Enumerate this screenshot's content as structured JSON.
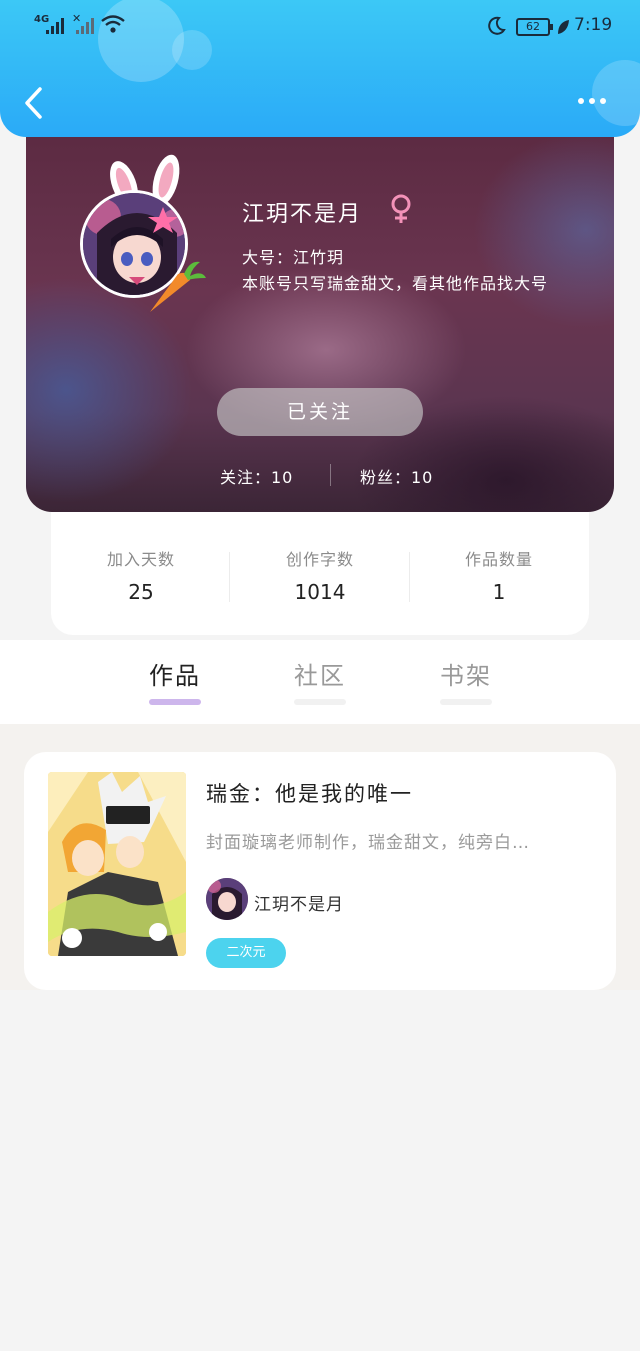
{
  "status_bar": {
    "network": "4G",
    "battery": "62",
    "time": "7:19"
  },
  "profile": {
    "nickname": "江玥不是月",
    "bio_line1": "大号：江竹玥",
    "bio_line2": "本账号只写瑞金甜文，看其他作品找大号",
    "follow_button": "已关注",
    "following": "关注：10",
    "followers": "粉丝：10"
  },
  "stats": [
    {
      "label": "加入天数",
      "value": "25"
    },
    {
      "label": "创作字数",
      "value": "1014"
    },
    {
      "label": "作品数量",
      "value": "1"
    }
  ],
  "tabs": [
    {
      "label": "作品",
      "active": true
    },
    {
      "label": "社区",
      "active": false
    },
    {
      "label": "书架",
      "active": false
    }
  ],
  "works": [
    {
      "title": "瑞金：他是我的唯一",
      "description": "封面璇璃老师制作，瑞金甜文，纯旁白…",
      "author": "江玥不是月",
      "tag": "二次元"
    }
  ],
  "colors": {
    "header": "#2aaaf7",
    "tab_underline_active": "#cdb6ec",
    "tag_bg": "#4cd3ee"
  },
  "icons": [
    "back-icon",
    "more-icon",
    "female-icon",
    "wifi-icon",
    "moon-icon"
  ]
}
